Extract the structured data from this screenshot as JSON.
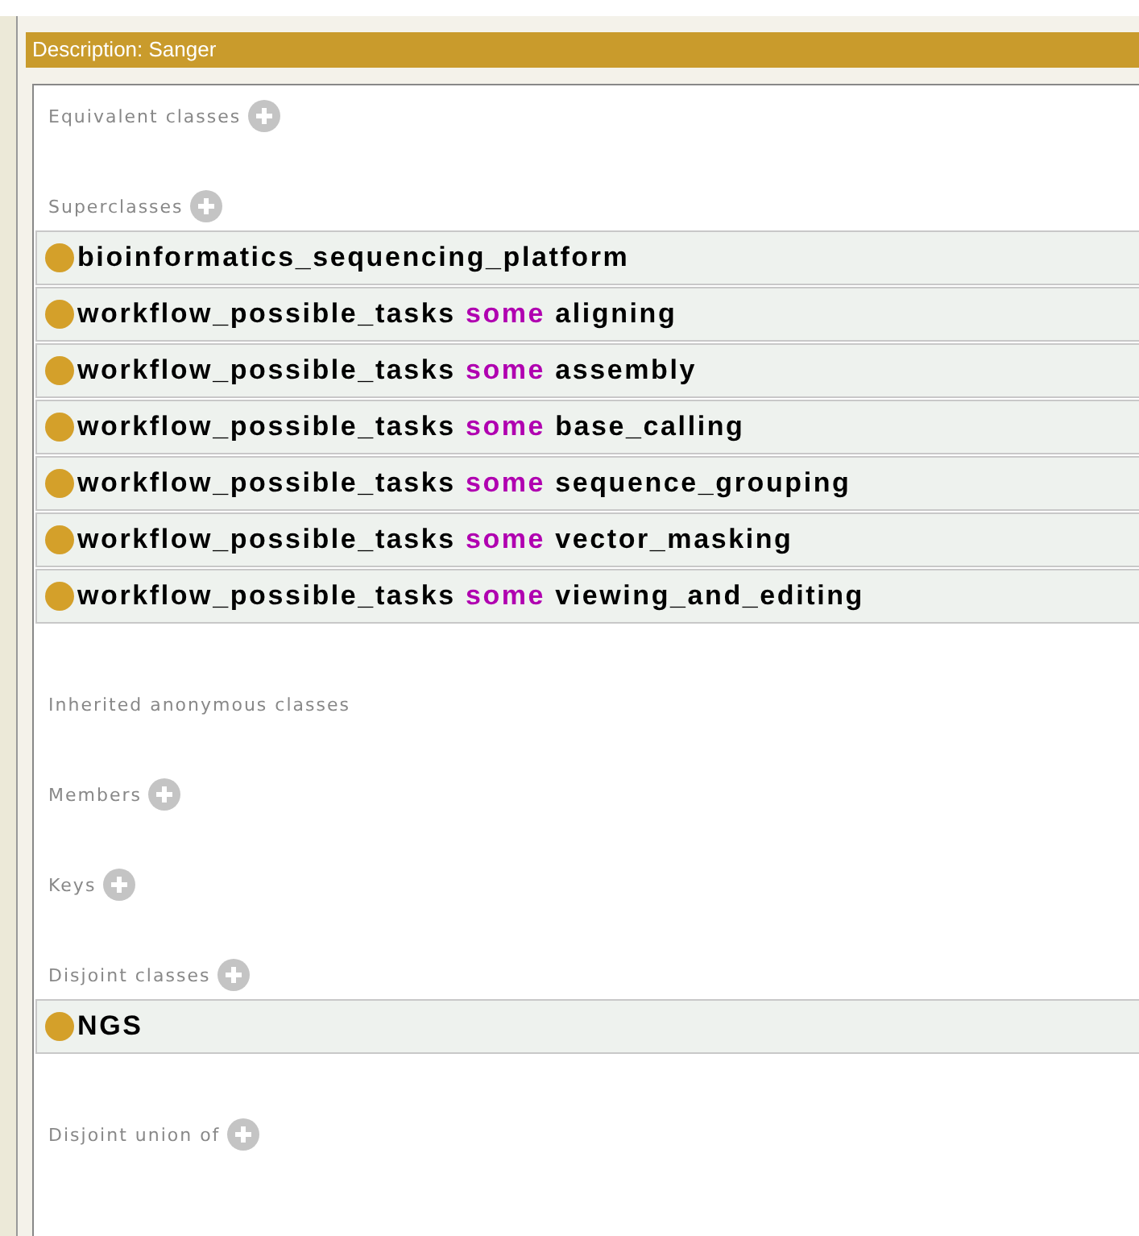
{
  "title": "Description: Sanger",
  "sections": [
    {
      "label": "Equivalent classes",
      "add_button": true
    },
    {
      "label": "Superclasses",
      "add_button": true,
      "items": [
        {
          "color": "#d4a02a",
          "parts": [
            {
              "kind": "entity",
              "text": "bioinformatics_sequencing_platform"
            }
          ]
        },
        {
          "color": "#d4a02a",
          "parts": [
            {
              "kind": "entity",
              "text": "workflow_possible_tasks"
            },
            {
              "kind": "keyword",
              "text": "some"
            },
            {
              "kind": "entity",
              "text": "aligning"
            }
          ]
        },
        {
          "color": "#d4a02a",
          "parts": [
            {
              "kind": "entity",
              "text": "workflow_possible_tasks"
            },
            {
              "kind": "keyword",
              "text": "some"
            },
            {
              "kind": "entity",
              "text": "assembly"
            }
          ]
        },
        {
          "color": "#d4a02a",
          "parts": [
            {
              "kind": "entity",
              "text": "workflow_possible_tasks"
            },
            {
              "kind": "keyword",
              "text": "some"
            },
            {
              "kind": "entity",
              "text": "base_calling"
            }
          ]
        },
        {
          "color": "#d4a02a",
          "parts": [
            {
              "kind": "entity",
              "text": "workflow_possible_tasks"
            },
            {
              "kind": "keyword",
              "text": "some"
            },
            {
              "kind": "entity",
              "text": "sequence_grouping"
            }
          ]
        },
        {
          "color": "#d4a02a",
          "parts": [
            {
              "kind": "entity",
              "text": "workflow_possible_tasks"
            },
            {
              "kind": "keyword",
              "text": "some"
            },
            {
              "kind": "entity",
              "text": "vector_masking"
            }
          ]
        },
        {
          "color": "#d4a02a",
          "parts": [
            {
              "kind": "entity",
              "text": "workflow_possible_tasks"
            },
            {
              "kind": "keyword",
              "text": "some"
            },
            {
              "kind": "entity",
              "text": "viewing_and_editing"
            }
          ]
        }
      ]
    },
    {
      "label": "Inherited anonymous classes",
      "add_button": false
    },
    {
      "label": "Members",
      "add_button": true
    },
    {
      "label": "Keys",
      "add_button": true
    },
    {
      "label": "Disjoint classes",
      "add_button": true,
      "items": [
        {
          "color": "#d4a02a",
          "parts": [
            {
              "kind": "entity",
              "text": "NGS"
            }
          ]
        }
      ]
    },
    {
      "label": "Disjoint union of",
      "add_button": true
    }
  ]
}
